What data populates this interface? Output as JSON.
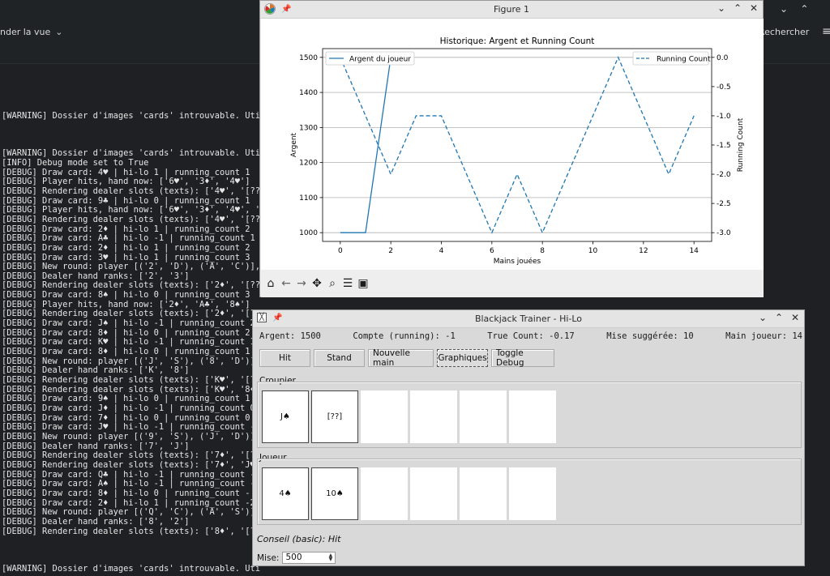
{
  "terminal": {
    "menu_label": "nder la vue",
    "search_label": "Rechercher",
    "lines": [
      "",
      "[WARNING] Dossier d'images 'cards' introuvable. Uti",
      "",
      "",
      "",
      "[WARNING] Dossier d'images 'cards' introuvable. Uti",
      "[INFO] Debug mode set to True",
      "[DEBUG] Draw card: 4♥ | hi-lo 1 | running_count 1",
      "[DEBUG] Player hits, hand now: ['6♥', '3♦', '4♥']",
      "[DEBUG] Rendering dealer slots (texts): ['4♥', '[??",
      "[DEBUG] Draw card: 9♣ | hi-lo 0 | running_count 1",
      "[DEBUG] Player hits, hand now: ['6♥', '3♦', '4♥', '",
      "[DEBUG] Rendering dealer slots (texts): ['4♥', '[??",
      "[DEBUG] Draw card: 2♦ | hi-lo 1 | running_count 2",
      "[DEBUG] Draw card: A♣ | hi-lo -1 | running_count 1",
      "[DEBUG] Draw card: 2♦ | hi-lo 1 | running_count 2",
      "[DEBUG] Draw card: 3♥ | hi-lo 1 | running_count 3",
      "[DEBUG] New round: player [('2', 'D'), ('A', 'C')],",
      "[DEBUG] Dealer hand ranks: ['2', '3']",
      "[DEBUG] Rendering dealer slots (texts): ['2♦', '[??",
      "[DEBUG] Draw card: 8♠ | hi-lo 0 | running_count 3",
      "[DEBUG] Player hits, hand now: ['2♦', 'A♣', '8♠']",
      "[DEBUG] Rendering dealer slots (texts): ['2♦', '[??]', '']",
      "[DEBUG] Draw card: J♠ | hi-lo -1 | running_count 2",
      "[DEBUG] Draw card: 8♦ | hi-lo 0 | running_count 2",
      "[DEBUG] Draw card: K♥ | hi-lo -1 | running_count 1",
      "[DEBUG] Draw card: 8♦ | hi-lo 0 | running_count 1",
      "[DEBUG] New round: player [('J', 'S'), ('8', 'D')]",
      "[DEBUG] Dealer hand ranks: ['K', '8']",
      "[DEBUG] Rendering dealer slots (texts): ['K♥', '[??",
      "[DEBUG] Rendering dealer slots (texts): ['K♥', '8♦",
      "[DEBUG] Draw card: 9♠ | hi-lo 0 | running_count 1",
      "[DEBUG] Draw card: J♦ | hi-lo -1 | running_count 0",
      "[DEBUG] Draw card: 7♦ | hi-lo 0 | running_count 0",
      "[DEBUG] Draw card: J♥ | hi-lo -1 | running_count -",
      "[DEBUG] New round: player [('9', 'S'), ('J', 'D')]",
      "[DEBUG] Dealer hand ranks: ['7', 'J']",
      "[DEBUG] Rendering dealer slots (texts): ['7♦', '[?",
      "[DEBUG] Rendering dealer slots (texts): ['7♦', 'J♥",
      "[DEBUG] Draw card: Q♣ | hi-lo -1 | running_count -",
      "[DEBUG] Draw card: A♠ | hi-lo -1 | running_count -",
      "[DEBUG] Draw card: 8♦ | hi-lo 0 | running_count -",
      "[DEBUG] Draw card: 2♦ | hi-lo 1 | running_count -2",
      "[DEBUG] New round: player [('Q', 'C'), ('A', 'S')]",
      "[DEBUG] Dealer hand ranks: ['8', '2']",
      "[DEBUG] Rendering dealer slots (texts): ['8♦', '[?",
      "",
      "",
      "",
      "[WARNING] Dossier d'images 'cards' introuvable. Uti"
    ]
  },
  "figure_window": {
    "title": "Figure 1",
    "toolbar_icons": [
      "home-icon",
      "back-arrow-icon",
      "forward-arrow-icon",
      "pan-icon",
      "zoom-icon",
      "configure-subplots-icon",
      "save-icon"
    ]
  },
  "chart_data": {
    "type": "line",
    "title": "Historique: Argent et Running Count",
    "xlabel": "Mains jouées",
    "ylabel": "Argent",
    "ylabel_right": "Running Count",
    "xlim": [
      -0.7,
      14.7
    ],
    "ylim": [
      975,
      1525
    ],
    "ylim_right": [
      -3.15,
      0.15
    ],
    "x_ticks": [
      0,
      2,
      4,
      6,
      8,
      10,
      12,
      14
    ],
    "y_ticks": [
      1000,
      1100,
      1200,
      1300,
      1400,
      1500
    ],
    "y_ticks_right": [
      0.0,
      -0.5,
      -1.0,
      -1.5,
      -2.0,
      -2.5,
      -3.0
    ],
    "grid": "horizontal",
    "series": [
      {
        "name": "Argent du joueur",
        "axis": "left",
        "style": "solid",
        "color": "#1f77b4",
        "x": [
          0,
          1,
          2
        ],
        "y": [
          1000,
          1000,
          1500
        ]
      },
      {
        "name": "Running Count",
        "axis": "right",
        "style": "dashed",
        "color": "#1f77b4",
        "x": [
          0,
          1,
          2,
          3,
          4,
          5,
          6,
          7,
          8,
          9,
          10,
          11,
          12,
          13,
          14
        ],
        "y": [
          0,
          -1,
          -2,
          -1,
          -1,
          -2,
          -3,
          -2,
          -3,
          -2,
          -1,
          0,
          -1,
          -2,
          -1
        ]
      }
    ],
    "legend_left": "top-left",
    "legend_right": "top-right"
  },
  "bj_window": {
    "title": "Blackjack Trainer - Hi-Lo",
    "info": {
      "argent": "Argent: 1500",
      "compte": "Compte (running): -1",
      "true_count": "True Count: -0.17",
      "mise_suggeree": "Mise suggérée: 10",
      "main_joueur": "Main joueur: 14"
    },
    "buttons": {
      "hit": "Hit",
      "stand": "Stand",
      "new_hand": "Nouvelle main",
      "graphs": "Graphiques",
      "toggle_debug": "Toggle Debug"
    },
    "dealer": {
      "label": "Croupier",
      "cards": [
        "J♠",
        "[??]",
        "",
        "",
        "",
        ""
      ]
    },
    "player": {
      "label": "Joueur",
      "cards": [
        "4♠",
        "10♠",
        "",
        "",
        "",
        ""
      ]
    },
    "advice": "Conseil (basic): Hit",
    "bet": {
      "label": "Mise:",
      "value": "500"
    }
  }
}
